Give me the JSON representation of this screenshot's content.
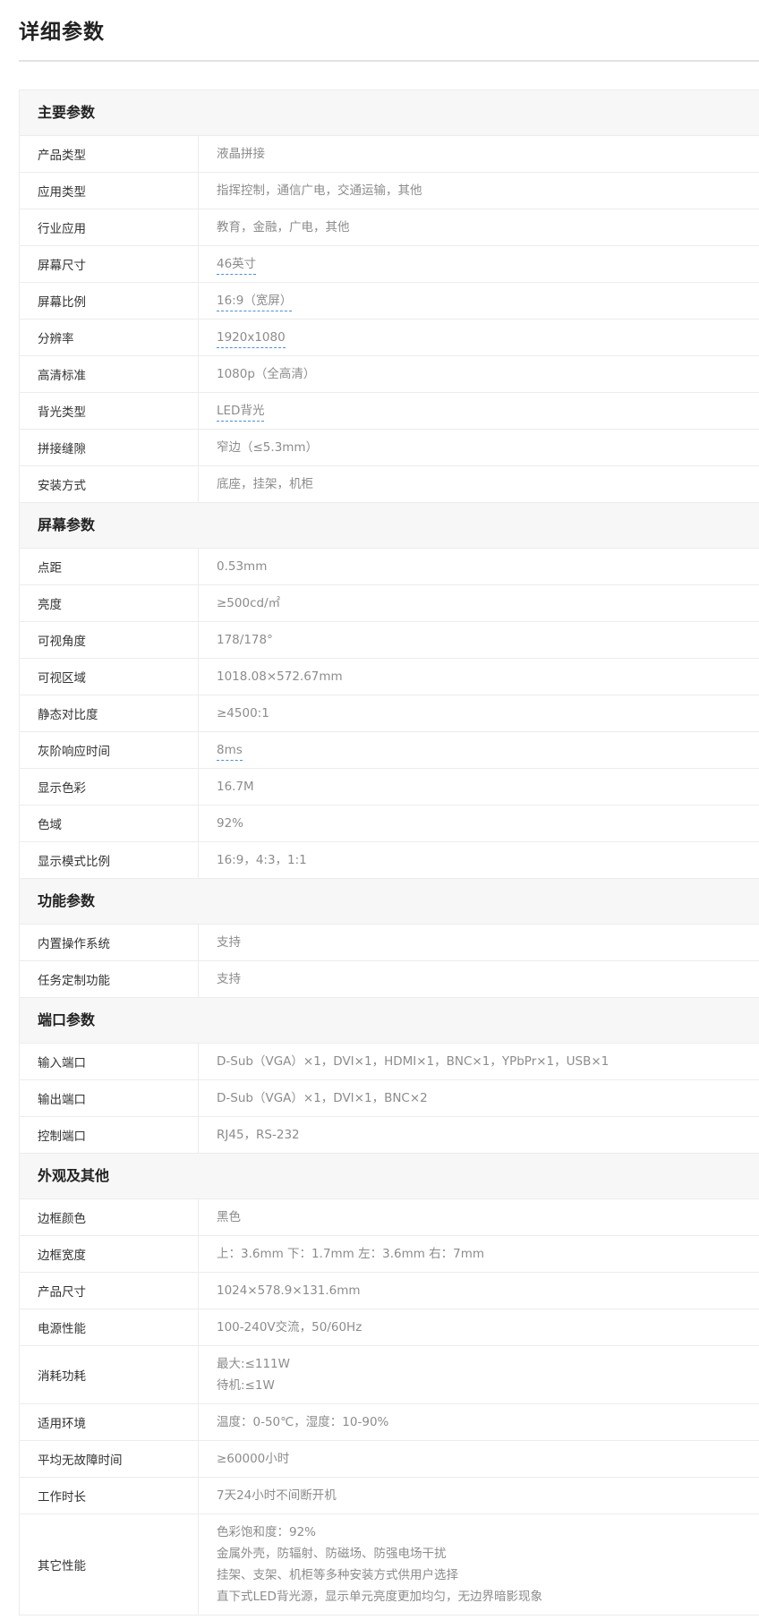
{
  "page_title": "详细参数",
  "sections": [
    {
      "title": "主要参数",
      "rows": [
        {
          "label": "产品类型",
          "lines": [
            "液晶拼接"
          ],
          "linked": false
        },
        {
          "label": "应用类型",
          "lines": [
            "指挥控制，通信广电，交通运输，其他"
          ],
          "linked": false
        },
        {
          "label": "行业应用",
          "lines": [
            "教育，金融，广电，其他"
          ],
          "linked": false
        },
        {
          "label": "屏幕尺寸",
          "lines": [
            "46英寸"
          ],
          "linked": true
        },
        {
          "label": "屏幕比例",
          "lines": [
            "16:9（宽屏）"
          ],
          "linked": true
        },
        {
          "label": "分辨率",
          "lines": [
            "1920x1080"
          ],
          "linked": true
        },
        {
          "label": "高清标准",
          "lines": [
            "1080p（全高清）"
          ],
          "linked": false
        },
        {
          "label": "背光类型",
          "lines": [
            "LED背光"
          ],
          "linked": true
        },
        {
          "label": "拼接缝隙",
          "lines": [
            "窄边（≤5.3mm）"
          ],
          "linked": false
        },
        {
          "label": "安装方式",
          "lines": [
            "底座，挂架，机柜"
          ],
          "linked": false
        }
      ]
    },
    {
      "title": "屏幕参数",
      "rows": [
        {
          "label": "点距",
          "lines": [
            "0.53mm"
          ],
          "linked": false
        },
        {
          "label": "亮度",
          "lines": [
            "≥500cd/㎡"
          ],
          "linked": false
        },
        {
          "label": "可视角度",
          "lines": [
            "178/178°"
          ],
          "linked": false
        },
        {
          "label": "可视区域",
          "lines": [
            "1018.08×572.67mm"
          ],
          "linked": false
        },
        {
          "label": "静态对比度",
          "lines": [
            "≥4500:1"
          ],
          "linked": false
        },
        {
          "label": "灰阶响应时间",
          "lines": [
            "8ms"
          ],
          "linked": true
        },
        {
          "label": "显示色彩",
          "lines": [
            "16.7M"
          ],
          "linked": false
        },
        {
          "label": "色域",
          "lines": [
            "92%"
          ],
          "linked": false
        },
        {
          "label": "显示模式比例",
          "lines": [
            "16:9，4:3，1:1"
          ],
          "linked": false
        }
      ]
    },
    {
      "title": "功能参数",
      "rows": [
        {
          "label": "内置操作系统",
          "lines": [
            "支持"
          ],
          "linked": false
        },
        {
          "label": "任务定制功能",
          "lines": [
            "支持"
          ],
          "linked": false
        }
      ]
    },
    {
      "title": "端口参数",
      "rows": [
        {
          "label": "输入端口",
          "lines": [
            "D-Sub（VGA）×1，DVI×1，HDMI×1，BNC×1，YPbPr×1，USB×1"
          ],
          "linked": false
        },
        {
          "label": "输出端口",
          "lines": [
            "D-Sub（VGA）×1，DVI×1，BNC×2"
          ],
          "linked": false
        },
        {
          "label": "控制端口",
          "lines": [
            "RJ45，RS-232"
          ],
          "linked": false
        }
      ]
    },
    {
      "title": "外观及其他",
      "rows": [
        {
          "label": "边框颜色",
          "lines": [
            "黑色"
          ],
          "linked": false
        },
        {
          "label": "边框宽度",
          "lines": [
            "上：3.6mm 下：1.7mm 左：3.6mm 右：7mm"
          ],
          "linked": false
        },
        {
          "label": "产品尺寸",
          "lines": [
            "1024×578.9×131.6mm"
          ],
          "linked": false
        },
        {
          "label": "电源性能",
          "lines": [
            "100-240V交流，50/60Hz"
          ],
          "linked": false
        },
        {
          "label": "消耗功耗",
          "lines": [
            "最大:≤111W",
            "待机:≤1W"
          ],
          "linked": false
        },
        {
          "label": "适用环境",
          "lines": [
            "温度：0-50℃，湿度：10-90%"
          ],
          "linked": false
        },
        {
          "label": "平均无故障时间",
          "lines": [
            "≥60000小时"
          ],
          "linked": false
        },
        {
          "label": "工作时长",
          "lines": [
            "7天24小时不间断开机"
          ],
          "linked": false
        },
        {
          "label": "其它性能",
          "lines": [
            "色彩饱和度：92%",
            "金属外壳，防辐射、防磁场、防强电场干扰",
            "挂架、支架、机柜等多种安装方式供用户选择",
            "直下式LED背光源，显示单元亮度更加均匀，无边界暗影现象"
          ],
          "linked": false
        }
      ]
    }
  ]
}
